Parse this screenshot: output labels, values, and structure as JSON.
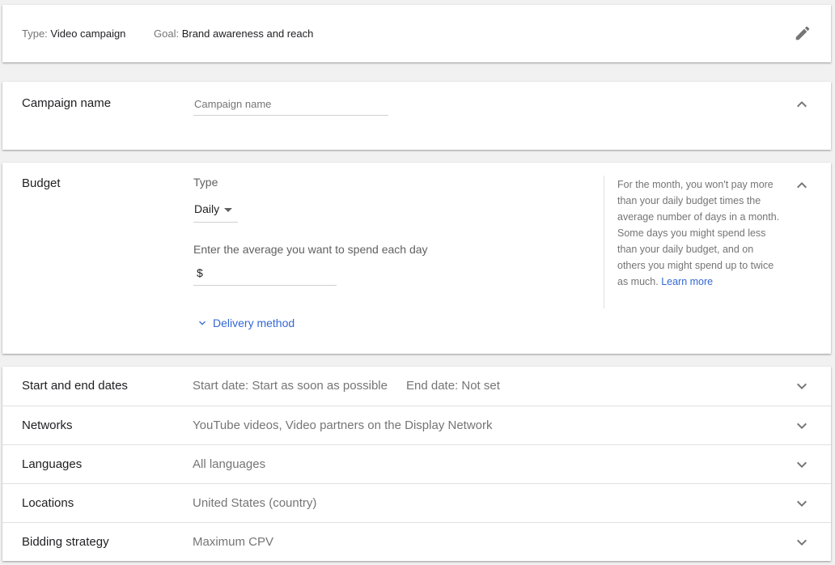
{
  "summary": {
    "type_label": "Type:",
    "type_value": "Video campaign",
    "goal_label": "Goal:",
    "goal_value": "Brand awareness and reach",
    "edit_icon": "pencil-icon"
  },
  "campaign_name": {
    "title": "Campaign name",
    "placeholder": "Campaign name",
    "value": ""
  },
  "budget": {
    "title": "Budget",
    "type_label": "Type",
    "type_selected": "Daily",
    "avg_label": "Enter the average you want to spend each day",
    "currency_symbol": "$",
    "amount_value": "",
    "delivery_method_label": "Delivery method",
    "help_text": "For the month, you won't pay more than your daily budget times the average number of days in a month. Some days you might spend less than your daily budget, and on others you might spend up to twice as much.",
    "learn_more": "Learn more"
  },
  "rows": [
    {
      "title": "Start and end dates",
      "value": "Start date: Start as soon as possible",
      "value2": "End date: Not set"
    },
    {
      "title": "Networks",
      "value": "YouTube videos, Video partners on the Display Network"
    },
    {
      "title": "Languages",
      "value": "All languages"
    },
    {
      "title": "Locations",
      "value": "United States (country)"
    },
    {
      "title": "Bidding strategy",
      "value": "Maximum CPV"
    }
  ],
  "colors": {
    "link": "#3367d6",
    "secondary_text": "#757575",
    "background": "#f1f1f1"
  }
}
